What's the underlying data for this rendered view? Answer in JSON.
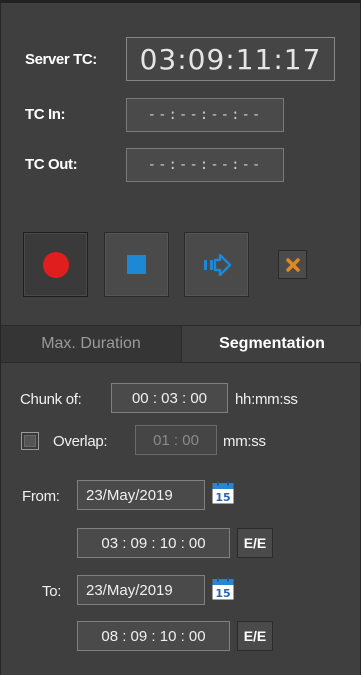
{
  "recorder": {
    "server_tc_label": "Server TC:",
    "server_tc_value": "03:09:11:17",
    "tc_in_label": "TC In:",
    "tc_in_value": "--:--:--:--",
    "tc_out_label": "TC Out:",
    "tc_out_value": "--:--:--:--"
  },
  "controls": {
    "record_icon": "record-circle-icon",
    "stop_icon": "stop-square-icon",
    "forward_icon": "arrow-right-icon",
    "cancel_icon": "x-icon"
  },
  "tabs": [
    {
      "label": "Max. Duration",
      "active": false
    },
    {
      "label": "Segmentation",
      "active": true
    }
  ],
  "segmentation": {
    "chunk_label": "Chunk of:",
    "chunk_value": "00 : 03 : 00",
    "chunk_unit": "hh:mm:ss",
    "overlap_label": "Overlap:",
    "overlap_checked": false,
    "overlap_value": "01 : 00",
    "overlap_unit": "mm:ss",
    "from_label": "From:",
    "from_date": "23/May/2019",
    "from_time": "03 : 09 : 10 : 00",
    "to_label": "To:",
    "to_date": "23/May/2019",
    "to_time": "08 : 09 : 10 : 00",
    "calendar_day": "15",
    "ee_label": "E/E"
  },
  "colors": {
    "record": "#e01e1e",
    "accent_blue": "#1d89d6",
    "cancel_orange": "#e08a1e",
    "background": "#3f3f3f"
  }
}
